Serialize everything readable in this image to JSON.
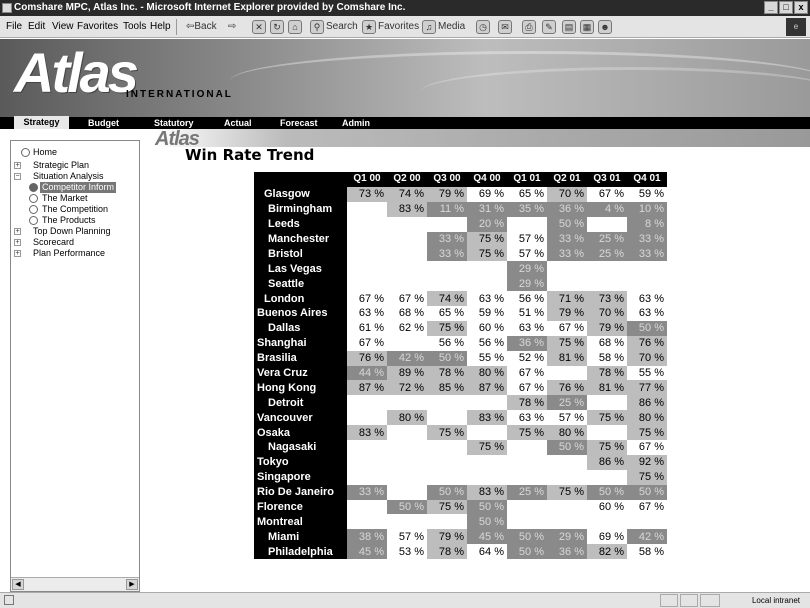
{
  "window": {
    "title": "Comshare MPC, Atlas Inc. - Microsoft Internet Explorer provided by Comshare Inc.",
    "controls": [
      "_",
      "×",
      "x"
    ]
  },
  "menubar": {
    "menus": [
      "File",
      "Edit",
      "View",
      "Favorites",
      "Tools",
      "Help"
    ],
    "toolbar": {
      "back": "⇦Back",
      "forward": "⇨",
      "search": "Search",
      "favorites": "Favorites",
      "media": "Media"
    }
  },
  "banner": {
    "brand": "Atlas",
    "brand_sub": "INTERNATIONAL"
  },
  "nav_tabs": [
    {
      "label": "Strategy",
      "active": true
    },
    {
      "label": "Budget",
      "active": false
    },
    {
      "label": "Statutory",
      "active": false
    },
    {
      "label": "Actual",
      "active": false
    },
    {
      "label": "Forecast",
      "active": false
    },
    {
      "label": "Admin",
      "active": false
    }
  ],
  "sidebar": {
    "items": [
      {
        "label": "Home"
      },
      {
        "label": "Strategic Plan"
      },
      {
        "label": "Situation Analysis"
      },
      {
        "label": "Competitor Inform"
      },
      {
        "label": "The Market"
      },
      {
        "label": "The Competition"
      },
      {
        "label": "The Products"
      },
      {
        "label": "Top Down Planning"
      },
      {
        "label": "Scorecard"
      },
      {
        "label": "Plan Performance"
      }
    ]
  },
  "content": {
    "logo": "Atlas",
    "page_title": "Win Rate Trend"
  },
  "table": {
    "columns": [
      "Q1 00",
      "Q2 00",
      "Q3 00",
      "Q4 00",
      "Q1 01",
      "Q2 01",
      "Q3 01",
      "Q4 01"
    ],
    "rows": [
      {
        "city": "Glasgow",
        "cells": [
          "73 %",
          "74 %",
          "79 %",
          "69 %",
          "65 %",
          "70 %",
          "67 %",
          "59 %"
        ]
      },
      {
        "city": "Birmingham",
        "cells": [
          "",
          "83 %",
          "11 %",
          "31 %",
          "35 %",
          "36 %",
          "4 %",
          "10 %"
        ]
      },
      {
        "city": "Leeds",
        "cells": [
          "",
          "",
          "",
          "20 %",
          "",
          "50 %",
          "",
          "8 %"
        ]
      },
      {
        "city": "Manchester",
        "cells": [
          "",
          "",
          "33 %",
          "75 %",
          "57 %",
          "33 %",
          "25 %",
          "33 %"
        ]
      },
      {
        "city": "Bristol",
        "cells": [
          "",
          "",
          "33 %",
          "75 %",
          "57 %",
          "33 %",
          "25 %",
          "33 %"
        ]
      },
      {
        "city": "Las Vegas",
        "cells": [
          "",
          "",
          "",
          "",
          "29 %",
          "",
          "",
          ""
        ]
      },
      {
        "city": "Seattle",
        "cells": [
          "",
          "",
          "",
          "",
          "29 %",
          "",
          "",
          ""
        ]
      },
      {
        "city": "London",
        "cells": [
          "67 %",
          "67 %",
          "74 %",
          "63 %",
          "56 %",
          "71 %",
          "73 %",
          "63 %"
        ]
      },
      {
        "city": "Buenos Aires",
        "cells": [
          "63 %",
          "68 %",
          "65 %",
          "59 %",
          "51 %",
          "79 %",
          "70 %",
          "63 %"
        ]
      },
      {
        "city": "Dallas",
        "cells": [
          "61 %",
          "62 %",
          "75 %",
          "60 %",
          "63 %",
          "67 %",
          "79 %",
          "50 %"
        ]
      },
      {
        "city": "Shanghai",
        "cells": [
          "67 %",
          "",
          "56 %",
          "56 %",
          "36 %",
          "75 %",
          "68 %",
          "76 %"
        ]
      },
      {
        "city": "Brasilia",
        "cells": [
          "76 %",
          "42 %",
          "50 %",
          "55 %",
          "52 %",
          "81 %",
          "58 %",
          "70 %"
        ]
      },
      {
        "city": "Vera Cruz",
        "cells": [
          "44 %",
          "89 %",
          "78 %",
          "80 %",
          "67 %",
          "",
          "78 %",
          "55 %"
        ]
      },
      {
        "city": "Hong Kong",
        "cells": [
          "87 %",
          "72 %",
          "85 %",
          "87 %",
          "67 %",
          "76 %",
          "81 %",
          "77 %"
        ]
      },
      {
        "city": "Detroit",
        "cells": [
          "",
          "",
          "",
          "",
          "78 %",
          "25 %",
          "",
          "86 %"
        ]
      },
      {
        "city": "Vancouver",
        "cells": [
          "",
          "80 %",
          "",
          "83 %",
          "63 %",
          "57 %",
          "75 %",
          "80 %"
        ]
      },
      {
        "city": "Osaka",
        "cells": [
          "83 %",
          "",
          "75 %",
          "",
          "75 %",
          "80 %",
          "",
          "75 %"
        ]
      },
      {
        "city": "Nagasaki",
        "cells": [
          "",
          "",
          "",
          "75 %",
          "",
          "50 %",
          "75 %",
          "67 %"
        ]
      },
      {
        "city": "Tokyo",
        "cells": [
          "",
          "",
          "",
          "",
          "",
          "",
          "86 %",
          "92 %"
        ]
      },
      {
        "city": "Singapore",
        "cells": [
          "",
          "",
          "",
          "",
          "",
          "",
          "",
          "75 %"
        ]
      },
      {
        "city": "Rio De Janeiro",
        "cells": [
          "33 %",
          "",
          "50 %",
          "83 %",
          "25 %",
          "75 %",
          "50 %",
          "50 %"
        ]
      },
      {
        "city": "Florence",
        "cells": [
          "",
          "50 %",
          "75 %",
          "50 %",
          "",
          "",
          "60 %",
          "67 %"
        ]
      },
      {
        "city": "Montreal",
        "cells": [
          "",
          "",
          "",
          "50 %",
          "",
          "",
          "",
          ""
        ]
      },
      {
        "city": "Miami",
        "cells": [
          "38 %",
          "57 %",
          "79 %",
          "45 %",
          "50 %",
          "29 %",
          "69 %",
          "42 %"
        ]
      },
      {
        "city": "Philadelphia",
        "cells": [
          "45 %",
          "53 %",
          "78 %",
          "64 %",
          "50 %",
          "36 %",
          "82 %",
          "58 %"
        ]
      }
    ]
  },
  "status": {
    "zone": "Local intranet"
  },
  "colors": {
    "win": "#ffffff",
    "neutral": "#bdbdbd",
    "low": "#8a8a8a",
    "header": "#000000"
  }
}
